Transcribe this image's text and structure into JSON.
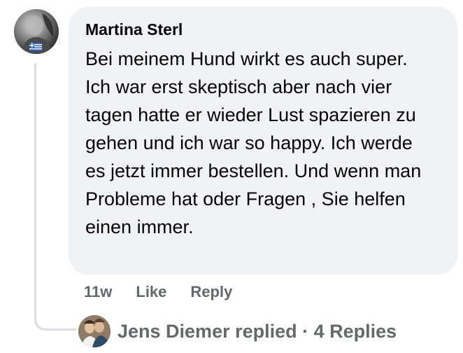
{
  "comment": {
    "author": "Martina Sterl",
    "text": "Bei meinem Hund wirkt es auch super. Ich war erst skeptisch aber nach vier tagen hatte er wieder Lust spazieren zu gehen und ich war so happy. Ich werde es jetzt immer bestellen. Und wenn man Probleme hat oder Fragen , Sie helfen einen immer.",
    "time": "11w",
    "like_label": "Like",
    "reply_label": "Reply",
    "avatar_icon": "profile-photo-icon",
    "flag_icon": "greek-flag-icon"
  },
  "replies": {
    "summary": "Jens Diemer replied · 4 Replies",
    "avatar_icon": "profile-photo-icon"
  },
  "colors": {
    "bubble": "#f0f2f5",
    "primary_text": "#050505",
    "secondary_text": "#65676b",
    "thread_line": "#dadde1"
  }
}
